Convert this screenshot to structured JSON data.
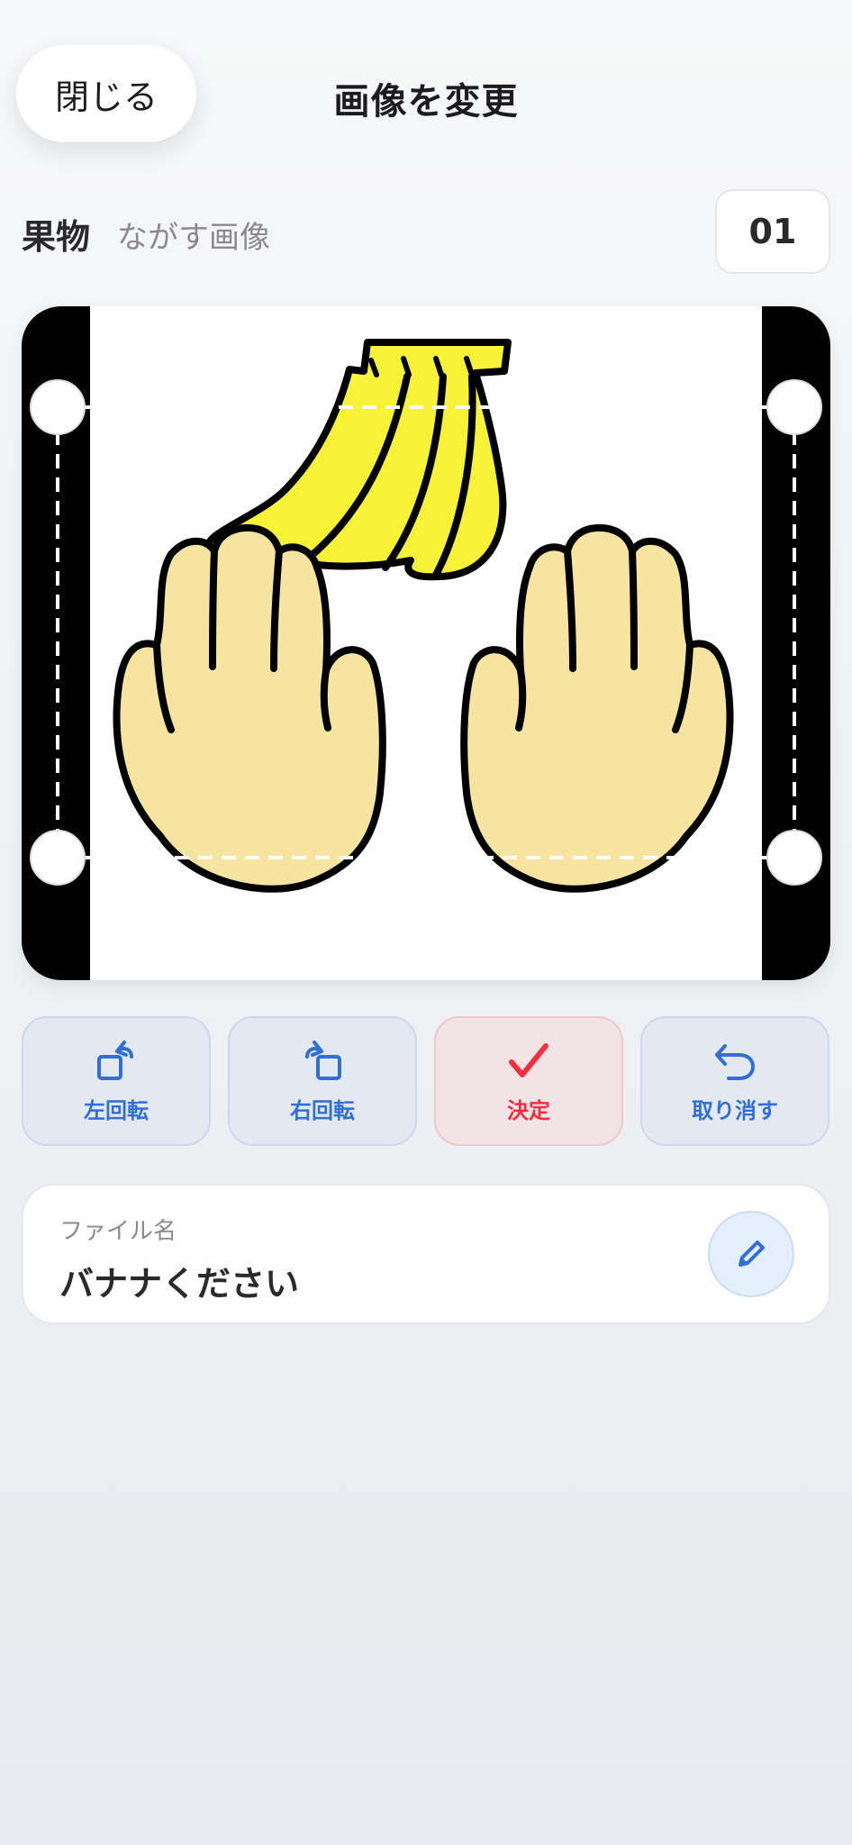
{
  "header": {
    "close_label": "閉じる",
    "title": "画像を変更"
  },
  "info": {
    "category": "果物",
    "subtitle": "ながす画像",
    "count": "01"
  },
  "actions": [
    {
      "label": "左回転",
      "icon": "rotate-left-icon",
      "color": "#2f6fd6"
    },
    {
      "label": "右回転",
      "icon": "rotate-right-icon",
      "color": "#2f6fd6"
    },
    {
      "label": "決定",
      "icon": "checkmark-icon",
      "color": "#f0303f"
    },
    {
      "label": "取り消す",
      "icon": "undo-icon",
      "color": "#2f6fd6"
    }
  ],
  "file": {
    "label": "ファイル名",
    "name": "バナナください",
    "edit_icon": "pencil-icon"
  },
  "image": {
    "subject": "banana-bunch-and-two-hands",
    "banana_color": "#f7f235",
    "hand_color": "#f7e4a0"
  }
}
